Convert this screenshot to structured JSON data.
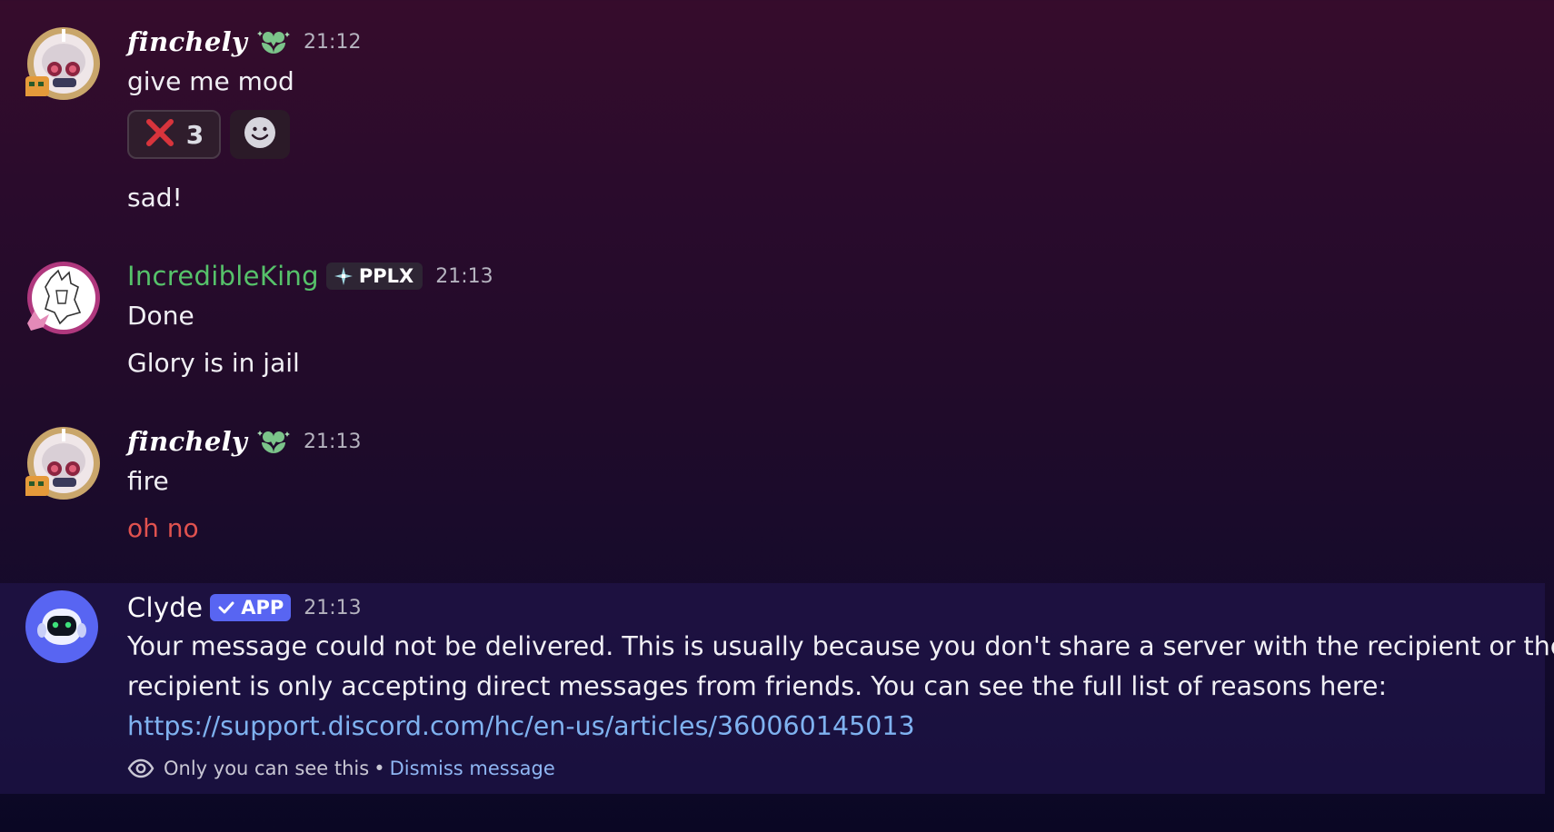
{
  "messages": {
    "finchely_1": {
      "username": "finchely",
      "time": "21:12",
      "lines": [
        "give me mod",
        "sad!"
      ],
      "reactions": [
        {
          "emoji": "cross-mark",
          "count": "3"
        }
      ]
    },
    "incredibleking": {
      "username": "IncredibleKing",
      "tag": "PPLX",
      "time": "21:13",
      "lines": [
        "Done",
        "Glory is in jail"
      ]
    },
    "finchely_2": {
      "username": "finchely",
      "time": "21:13",
      "lines": [
        "fire",
        "oh no"
      ]
    },
    "clyde": {
      "username": "Clyde",
      "tag": "APP",
      "time": "21:13",
      "body_line1": "Your message could not be delivered. This is usually because you don't share a server with the recipient or the",
      "body_line2": "recipient is only accepting direct messages from friends. You can see the full list of reasons here:",
      "link": "https://support.discord.com/hc/en-us/articles/360060145013",
      "ephemeral_note": "Only you can see this",
      "separator": "•",
      "dismiss_label": "Dismiss message"
    }
  },
  "colors": {
    "username_green": "#56c26a",
    "error_red": "#e0524f",
    "link_blue": "#7fb2f0",
    "app_badge": "#5865f2"
  }
}
